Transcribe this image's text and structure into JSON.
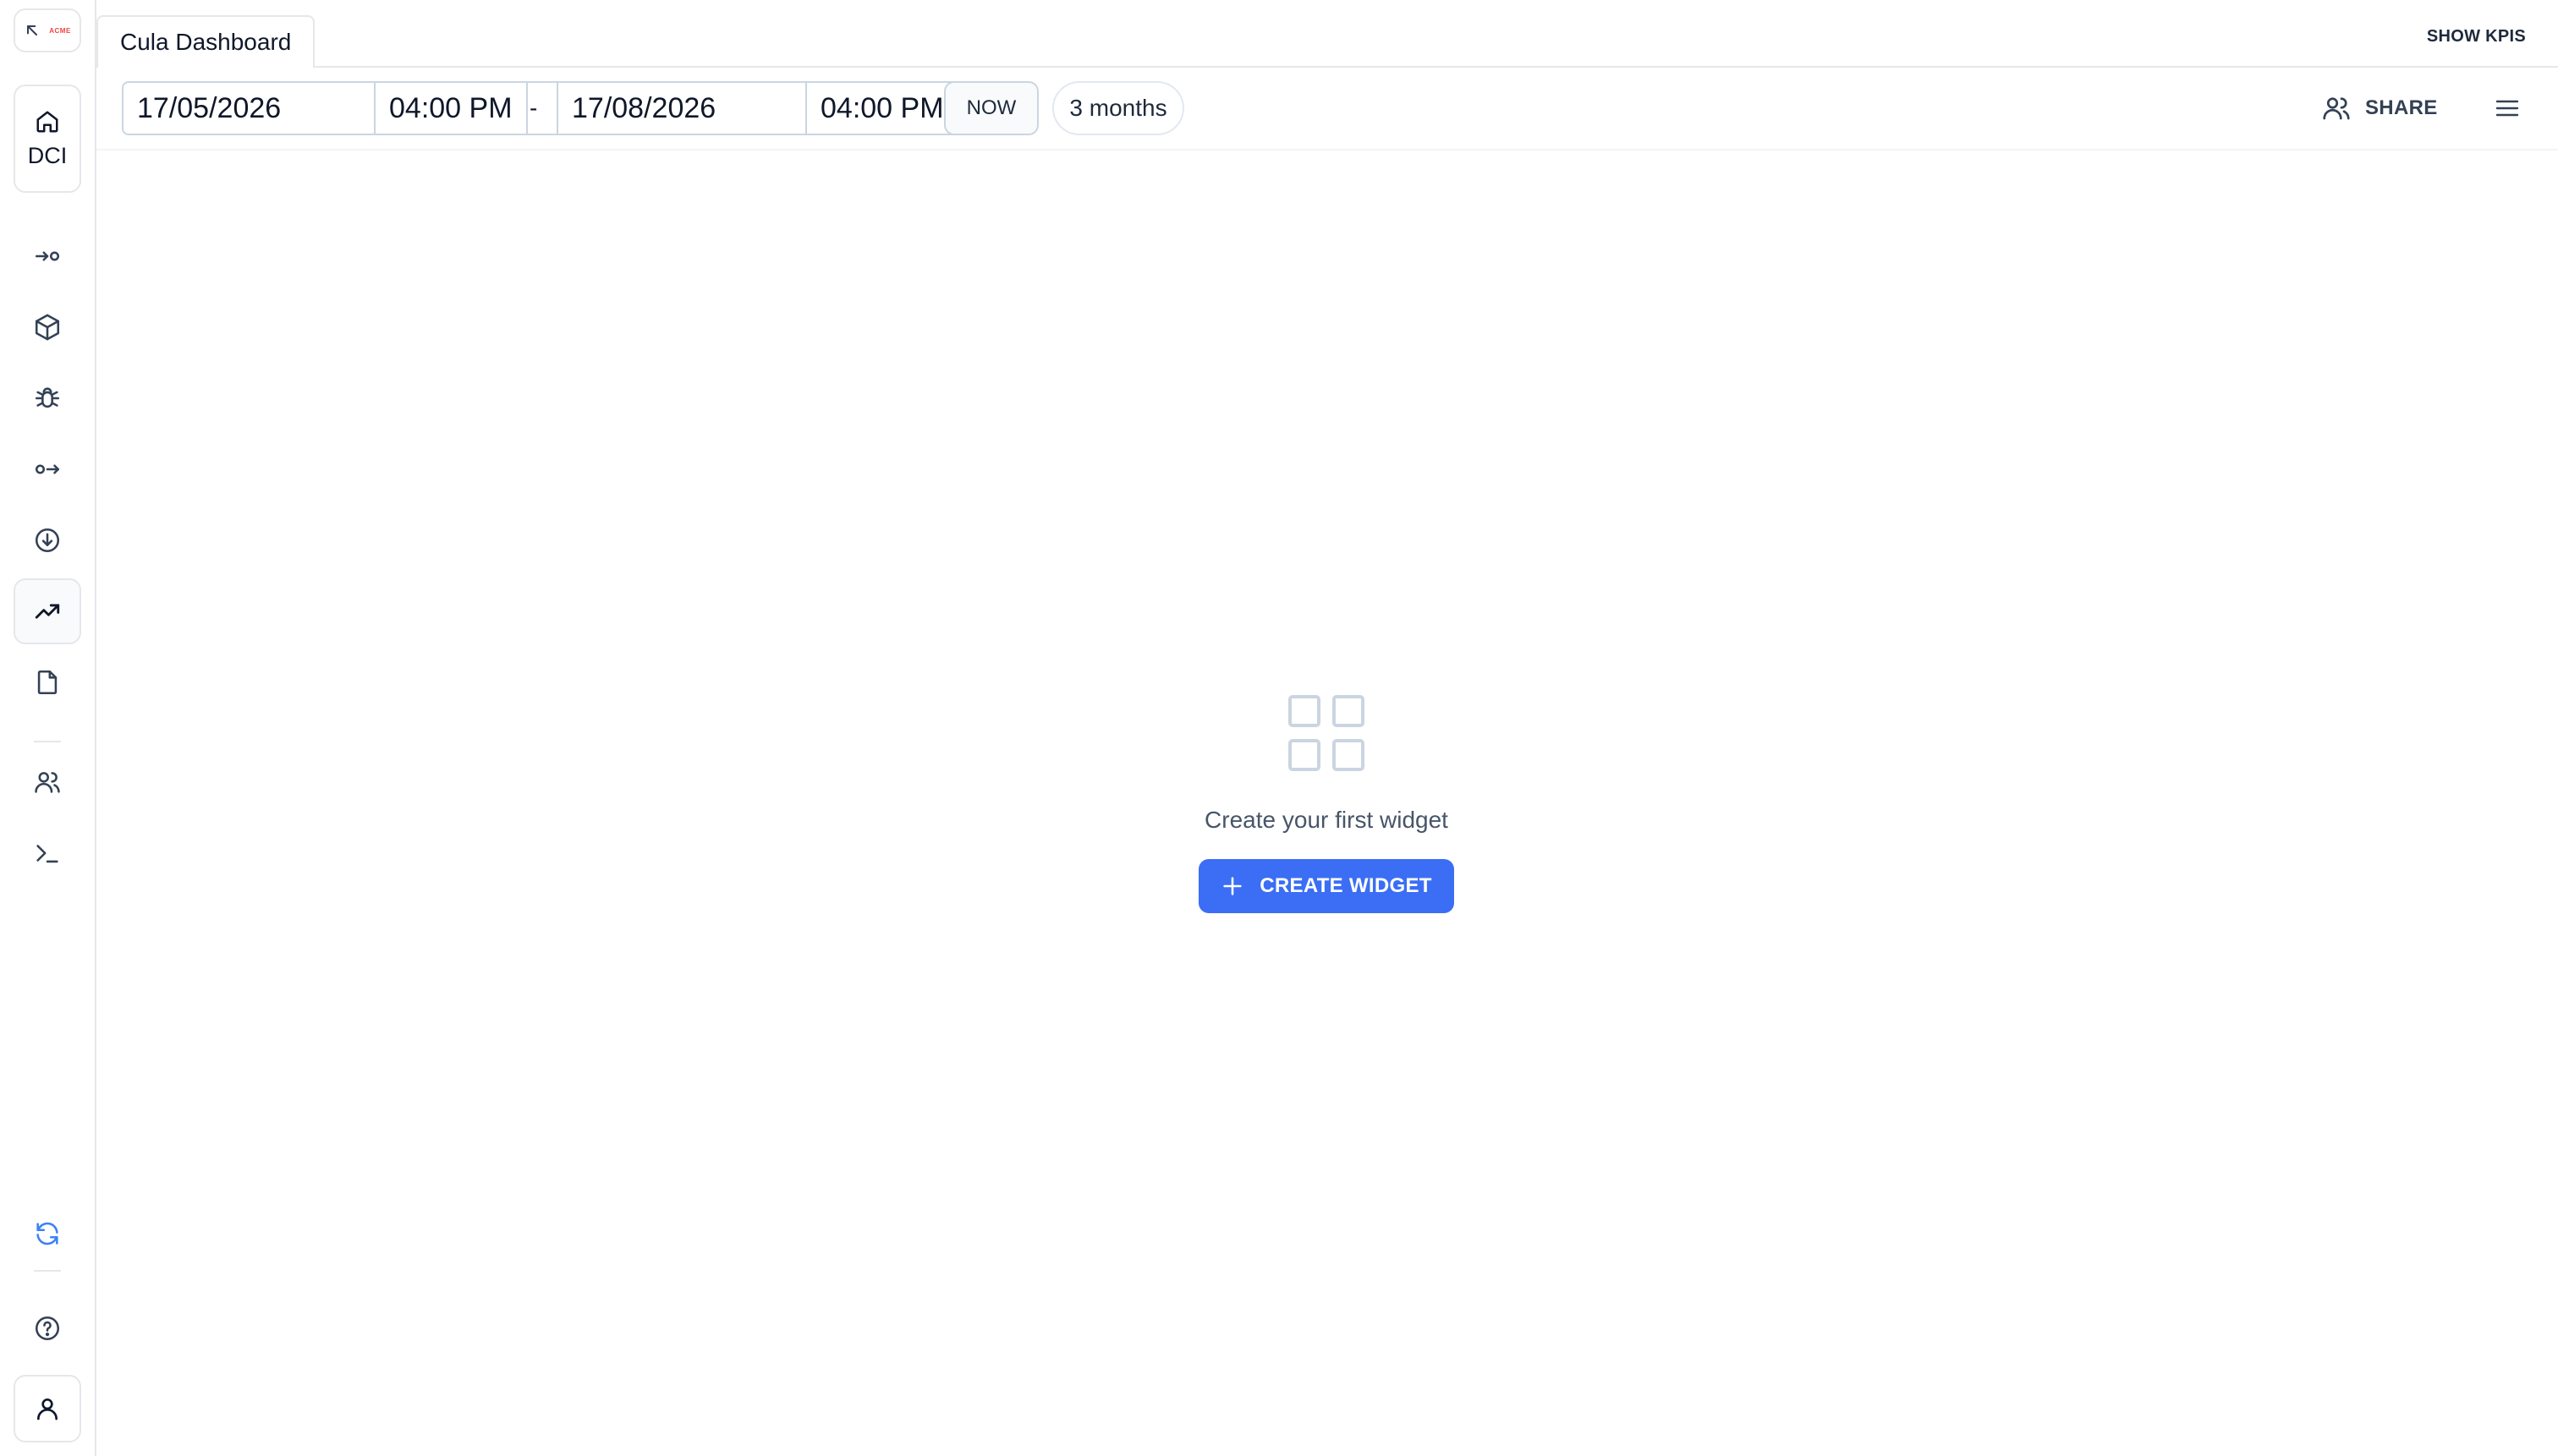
{
  "sidebar": {
    "logo_text": "ACME",
    "home_label": "DCI",
    "nav_icons": [
      "sign-in-icon",
      "package-icon",
      "bug-icon",
      "sign-out-icon",
      "download-circle-icon",
      "trend-up-icon",
      "file-icon",
      "users-icon",
      "terminal-icon"
    ],
    "active": "trend-up-icon"
  },
  "tabs": [
    {
      "label": "Cula Dashboard",
      "active": true
    }
  ],
  "header": {
    "show_kpis_label": "SHOW KPIS"
  },
  "toolbar": {
    "start_date": "17/05/2026",
    "start_time": "04:00 PM",
    "separator": "-",
    "end_date": "17/08/2026",
    "end_time": "04:00 PM",
    "now_label": "NOW",
    "range_label": "3 months",
    "share_label": "SHARE"
  },
  "empty_state": {
    "message": "Create your first widget",
    "create_label": "CREATE WIDGET"
  },
  "colors": {
    "primary": "#3b6ef5",
    "border": "#e5e7eb",
    "sync_icon": "#3b82f6",
    "logo_accent": "#ef4444"
  }
}
